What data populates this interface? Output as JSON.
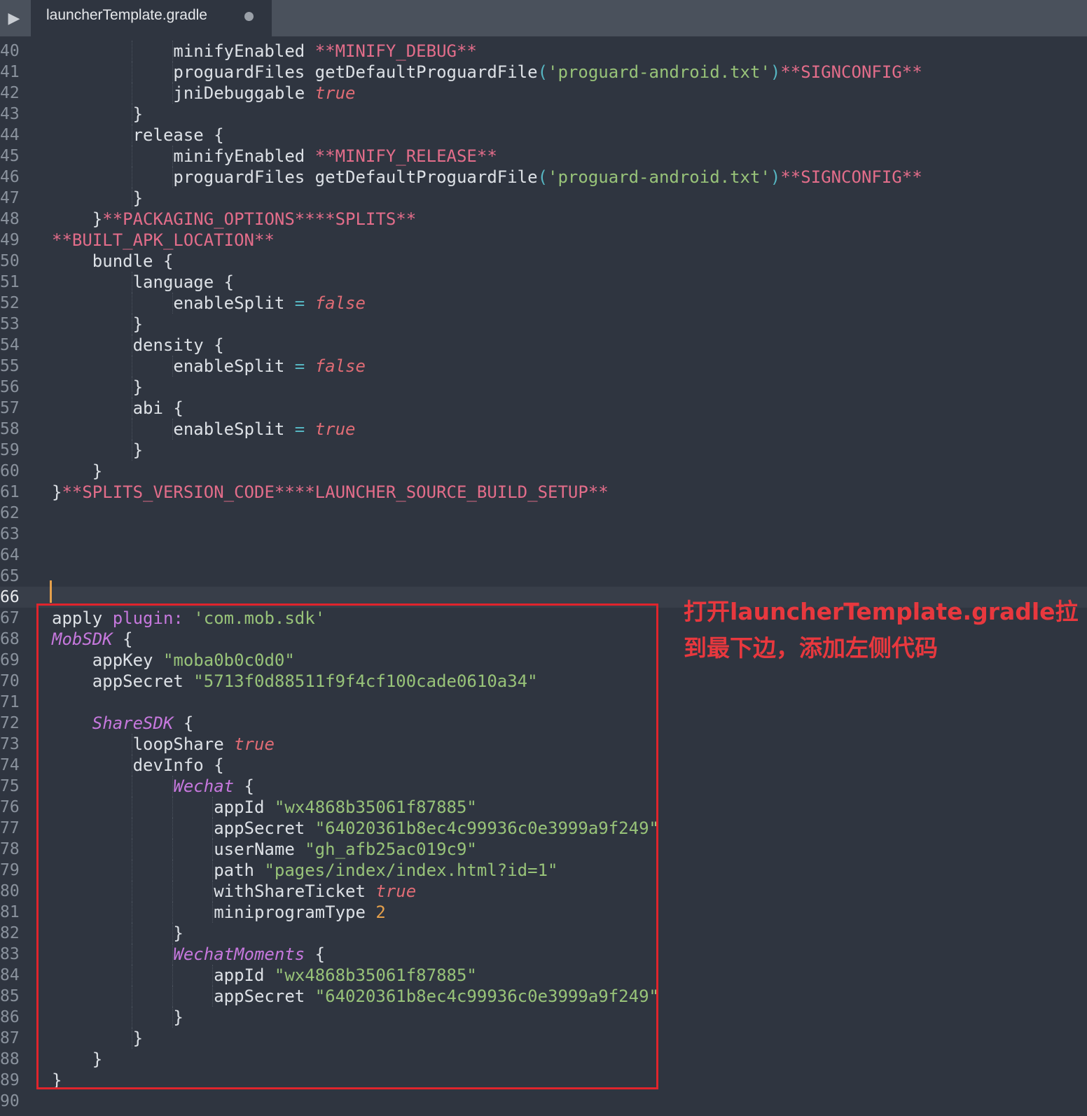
{
  "tab": {
    "title": "launcherTemplate.gradle",
    "run_icon": "play-icon",
    "modified_icon": "unsaved-dot-icon"
  },
  "annotation": {
    "line1": "打开launcherTemplate.gradle拉",
    "line2": "到最下边，添加左侧代码"
  },
  "colors": {
    "background": "#2f3540",
    "string": "#98c379",
    "boolean": "#e06c75",
    "placeholder": "#e36d8a",
    "class": "#c678dd",
    "annotation": "#e0242c"
  },
  "active_line": 66,
  "lines": [
    {
      "n": "40",
      "indent": 3,
      "tokens": [
        {
          "t": "minifyEnabled "
        },
        {
          "t": "**MINIFY_DEBUG**",
          "c": "ph"
        }
      ]
    },
    {
      "n": "41",
      "indent": 3,
      "tokens": [
        {
          "t": "proguardFiles getDefaultProguardFile"
        },
        {
          "t": "(",
          "c": "op"
        },
        {
          "t": "'proguard-android.txt'",
          "c": "str"
        },
        {
          "t": ")",
          "c": "op"
        },
        {
          "t": "**SIGNCONFIG**",
          "c": "ph"
        }
      ]
    },
    {
      "n": "42",
      "indent": 3,
      "tokens": [
        {
          "t": "jniDebuggable "
        },
        {
          "t": "true",
          "c": "bool"
        }
      ]
    },
    {
      "n": "43",
      "indent": 2,
      "tokens": [
        {
          "t": "}"
        }
      ]
    },
    {
      "n": "44",
      "indent": 2,
      "tokens": [
        {
          "t": "release {"
        }
      ]
    },
    {
      "n": "45",
      "indent": 3,
      "tokens": [
        {
          "t": "minifyEnabled "
        },
        {
          "t": "**MINIFY_RELEASE**",
          "c": "ph"
        }
      ]
    },
    {
      "n": "46",
      "indent": 3,
      "tokens": [
        {
          "t": "proguardFiles getDefaultProguardFile"
        },
        {
          "t": "(",
          "c": "op"
        },
        {
          "t": "'proguard-android.txt'",
          "c": "str"
        },
        {
          "t": ")",
          "c": "op"
        },
        {
          "t": "**SIGNCONFIG**",
          "c": "ph"
        }
      ]
    },
    {
      "n": "47",
      "indent": 2,
      "tokens": [
        {
          "t": "}"
        }
      ]
    },
    {
      "n": "48",
      "indent": 1,
      "tokens": [
        {
          "t": "}"
        },
        {
          "t": "**PACKAGING_OPTIONS****SPLITS**",
          "c": "ph"
        }
      ]
    },
    {
      "n": "49",
      "indent": 0,
      "tokens": [
        {
          "t": "**BUILT_APK_LOCATION**",
          "c": "ph"
        }
      ]
    },
    {
      "n": "50",
      "indent": 1,
      "tokens": [
        {
          "t": "bundle {"
        }
      ]
    },
    {
      "n": "51",
      "indent": 2,
      "tokens": [
        {
          "t": "language {"
        }
      ]
    },
    {
      "n": "52",
      "indent": 3,
      "tokens": [
        {
          "t": "enableSplit "
        },
        {
          "t": "=",
          "c": "op"
        },
        {
          "t": " "
        },
        {
          "t": "false",
          "c": "bool"
        }
      ]
    },
    {
      "n": "53",
      "indent": 2,
      "tokens": [
        {
          "t": "}"
        }
      ]
    },
    {
      "n": "54",
      "indent": 2,
      "tokens": [
        {
          "t": "density {"
        }
      ]
    },
    {
      "n": "55",
      "indent": 3,
      "tokens": [
        {
          "t": "enableSplit "
        },
        {
          "t": "=",
          "c": "op"
        },
        {
          "t": " "
        },
        {
          "t": "false",
          "c": "bool"
        }
      ]
    },
    {
      "n": "56",
      "indent": 2,
      "tokens": [
        {
          "t": "}"
        }
      ]
    },
    {
      "n": "57",
      "indent": 2,
      "tokens": [
        {
          "t": "abi {"
        }
      ]
    },
    {
      "n": "58",
      "indent": 3,
      "tokens": [
        {
          "t": "enableSplit "
        },
        {
          "t": "=",
          "c": "op"
        },
        {
          "t": " "
        },
        {
          "t": "true",
          "c": "bool"
        }
      ]
    },
    {
      "n": "59",
      "indent": 2,
      "tokens": [
        {
          "t": "}"
        }
      ]
    },
    {
      "n": "60",
      "indent": 1,
      "tokens": [
        {
          "t": "}"
        }
      ]
    },
    {
      "n": "61",
      "indent": 0,
      "tokens": [
        {
          "t": "}"
        },
        {
          "t": "**SPLITS_VERSION_CODE****LAUNCHER_SOURCE_BUILD_SETUP**",
          "c": "ph"
        }
      ]
    },
    {
      "n": "62",
      "indent": 0,
      "tokens": []
    },
    {
      "n": "63",
      "indent": 0,
      "tokens": []
    },
    {
      "n": "64",
      "indent": 0,
      "tokens": []
    },
    {
      "n": "65",
      "indent": 0,
      "tokens": []
    },
    {
      "n": "66",
      "indent": 0,
      "tokens": []
    },
    {
      "n": "67",
      "indent": 0,
      "tokens": [
        {
          "t": "apply "
        },
        {
          "t": "plugin:",
          "c": "plugin"
        },
        {
          "t": " "
        },
        {
          "t": "'com.mob.sdk'",
          "c": "str"
        }
      ]
    },
    {
      "n": "68",
      "indent": 0,
      "tokens": [
        {
          "t": "MobSDK",
          "c": "cls"
        },
        {
          "t": " {"
        }
      ]
    },
    {
      "n": "69",
      "indent": 1,
      "tokens": [
        {
          "t": "appKey "
        },
        {
          "t": "\"moba0b0c0d0\"",
          "c": "str"
        }
      ]
    },
    {
      "n": "70",
      "indent": 1,
      "tokens": [
        {
          "t": "appSecret "
        },
        {
          "t": "\"5713f0d88511f9f4cf100cade0610a34\"",
          "c": "str"
        }
      ]
    },
    {
      "n": "71",
      "indent": 0,
      "tokens": []
    },
    {
      "n": "72",
      "indent": 1,
      "tokens": [
        {
          "t": "ShareSDK",
          "c": "cls"
        },
        {
          "t": " {"
        }
      ]
    },
    {
      "n": "73",
      "indent": 2,
      "tokens": [
        {
          "t": "loopShare "
        },
        {
          "t": "true",
          "c": "bool"
        }
      ]
    },
    {
      "n": "74",
      "indent": 2,
      "tokens": [
        {
          "t": "devInfo {"
        }
      ]
    },
    {
      "n": "75",
      "indent": 3,
      "tokens": [
        {
          "t": "Wechat",
          "c": "cls"
        },
        {
          "t": " {"
        }
      ]
    },
    {
      "n": "76",
      "indent": 4,
      "tokens": [
        {
          "t": "appId "
        },
        {
          "t": "\"wx4868b35061f87885\"",
          "c": "str"
        }
      ]
    },
    {
      "n": "77",
      "indent": 4,
      "tokens": [
        {
          "t": "appSecret "
        },
        {
          "t": "\"64020361b8ec4c99936c0e3999a9f249\"",
          "c": "str"
        }
      ]
    },
    {
      "n": "78",
      "indent": 4,
      "tokens": [
        {
          "t": "userName "
        },
        {
          "t": "\"gh_afb25ac019c9\"",
          "c": "str"
        }
      ]
    },
    {
      "n": "79",
      "indent": 4,
      "tokens": [
        {
          "t": "path "
        },
        {
          "t": "\"pages/index/index.html?id=1\"",
          "c": "str"
        }
      ]
    },
    {
      "n": "80",
      "indent": 4,
      "tokens": [
        {
          "t": "withShareTicket "
        },
        {
          "t": "true",
          "c": "bool"
        }
      ]
    },
    {
      "n": "81",
      "indent": 4,
      "tokens": [
        {
          "t": "miniprogramType "
        },
        {
          "t": "2",
          "c": "num"
        }
      ]
    },
    {
      "n": "82",
      "indent": 3,
      "tokens": [
        {
          "t": "}"
        }
      ]
    },
    {
      "n": "83",
      "indent": 3,
      "tokens": [
        {
          "t": "WechatMoments",
          "c": "cls"
        },
        {
          "t": " {"
        }
      ]
    },
    {
      "n": "84",
      "indent": 4,
      "tokens": [
        {
          "t": "appId "
        },
        {
          "t": "\"wx4868b35061f87885\"",
          "c": "str"
        }
      ]
    },
    {
      "n": "85",
      "indent": 4,
      "tokens": [
        {
          "t": "appSecret "
        },
        {
          "t": "\"64020361b8ec4c99936c0e3999a9f249\"",
          "c": "str"
        }
      ]
    },
    {
      "n": "86",
      "indent": 3,
      "tokens": [
        {
          "t": "}"
        }
      ]
    },
    {
      "n": "87",
      "indent": 2,
      "tokens": [
        {
          "t": "}"
        }
      ]
    },
    {
      "n": "88",
      "indent": 1,
      "tokens": [
        {
          "t": "}"
        }
      ]
    },
    {
      "n": "89",
      "indent": 0,
      "tokens": [
        {
          "t": "}"
        }
      ]
    },
    {
      "n": "90",
      "indent": 0,
      "tokens": []
    }
  ]
}
